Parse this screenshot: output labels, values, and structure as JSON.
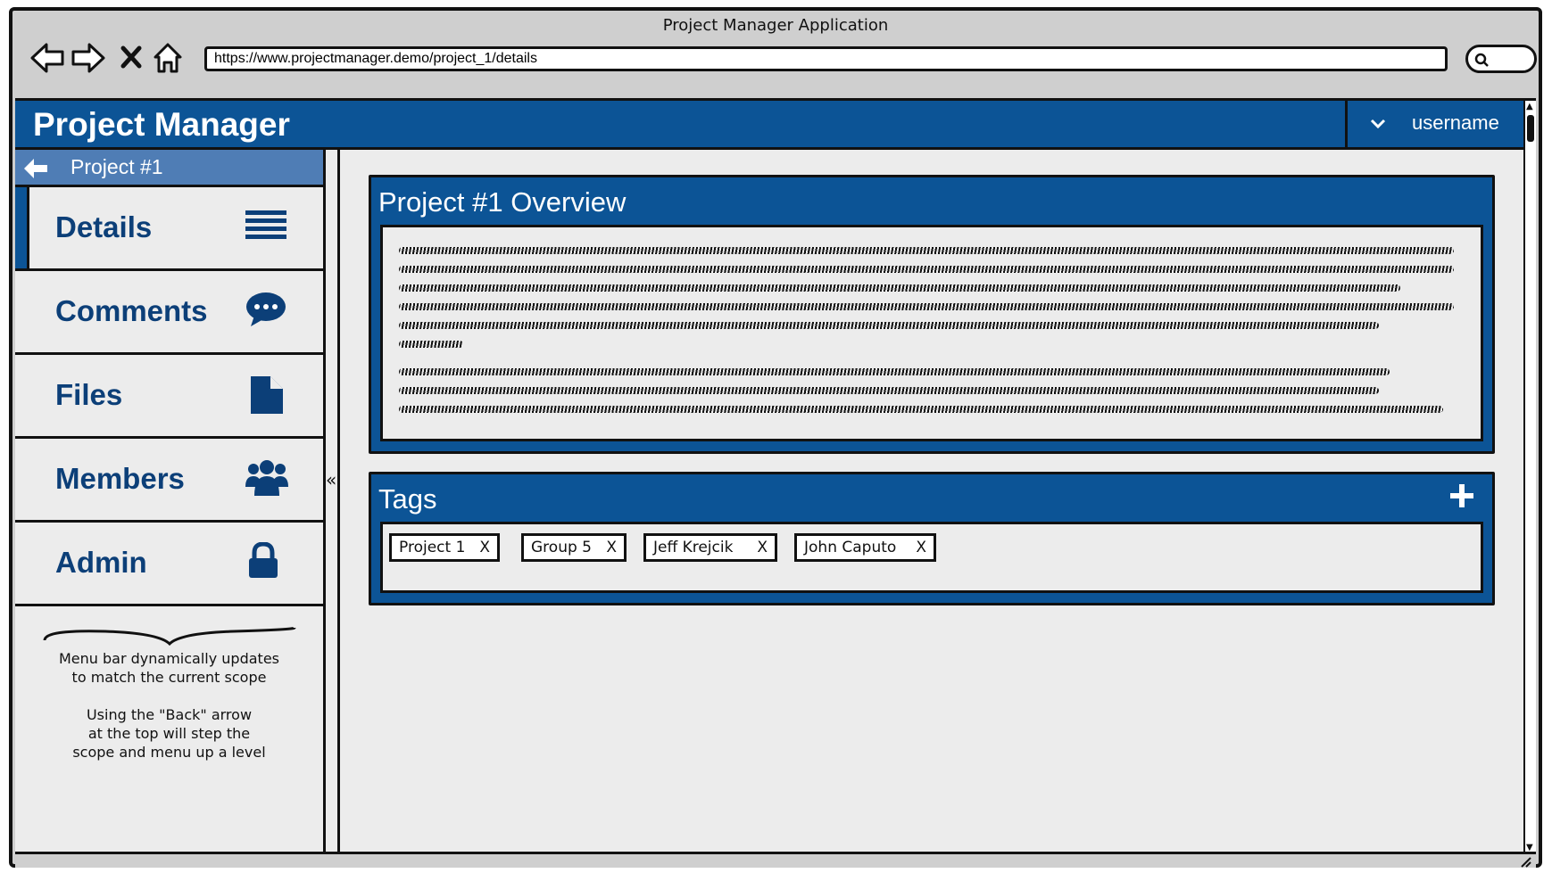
{
  "window": {
    "title": "Project Manager Application",
    "url": "https://www.projectmanager.demo/project_1/details"
  },
  "browser_buttons": [
    "back-arrow-icon",
    "forward-arrow-icon",
    "stop-icon",
    "home-icon"
  ],
  "header": {
    "app_title": "Project Manager",
    "username": "username",
    "brand_color": "#0c5496"
  },
  "sidebar": {
    "back_label": "Project #1",
    "items": [
      {
        "label": "Details",
        "icon": "list-icon",
        "active": true
      },
      {
        "label": "Comments",
        "icon": "comment-bubble-icon",
        "active": false
      },
      {
        "label": "Files",
        "icon": "file-icon",
        "active": false
      },
      {
        "label": "Members",
        "icon": "users-icon",
        "active": false
      },
      {
        "label": "Admin",
        "icon": "lock-icon",
        "active": false
      }
    ],
    "note_line1": "Menu bar dynamically updates",
    "note_line2": "to match the current scope",
    "note_line3": "Using the \"Back\" arrow",
    "note_line4": "at the top will step the",
    "note_line5": "scope and menu up a level"
  },
  "overview": {
    "title": "Project #1 Overview"
  },
  "tags": {
    "title": "Tags",
    "items": [
      "Project 1",
      "Group 5",
      "Jeff Krejcik",
      "John Caputo"
    ],
    "remove_label": "X"
  }
}
